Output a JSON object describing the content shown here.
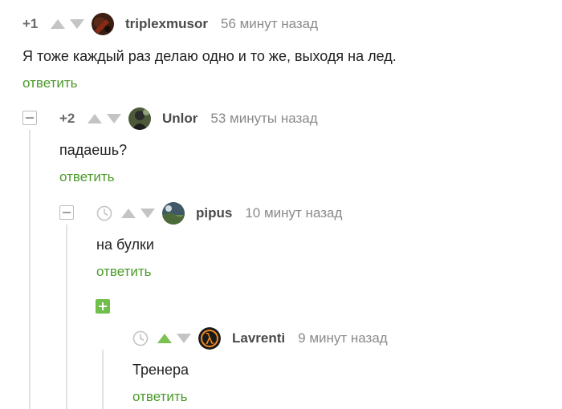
{
  "comments": [
    {
      "rating": "+1",
      "username": "triplexmusor",
      "time": "56 минут назад",
      "text": "Я тоже каждый раз делаю одно и то же, выходя на лед.",
      "reply_label": "ответить",
      "avatar_icon": "dark-avatar"
    },
    {
      "rating": "+2",
      "username": "Unlor",
      "time": "53 минуты назад",
      "text": "падаешь?",
      "reply_label": "ответить",
      "avatar_icon": "photo-avatar"
    },
    {
      "rating": "",
      "username": "pipus",
      "time": "10 минут назад",
      "text": "на булки",
      "reply_label": "ответить",
      "avatar_icon": "landscape-avatar"
    },
    {
      "rating": "",
      "username": "Lavrenti",
      "time": "9 минут назад",
      "text": "Тренера",
      "reply_label": "ответить",
      "avatar_icon": "half-life-lambda-avatar"
    }
  ],
  "colors": {
    "accent_green": "#4c9a2a",
    "upvote_active": "#7cc152",
    "arrow_inactive": "#c4c4c4"
  }
}
